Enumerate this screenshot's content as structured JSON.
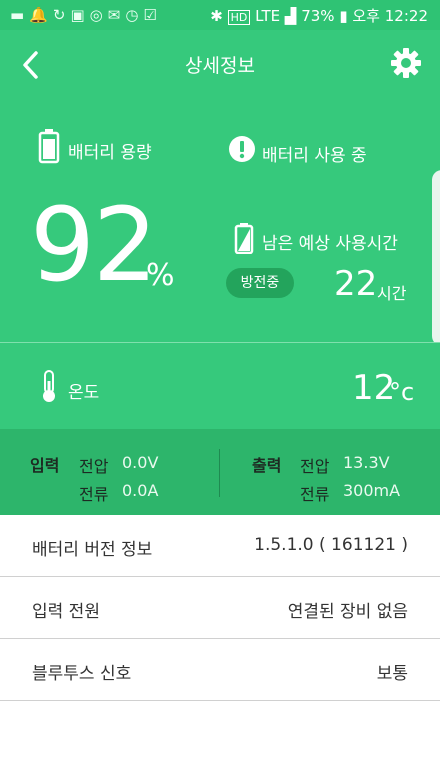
{
  "status_bar": {
    "notification_icons": [
      "message-icon",
      "bell-icon",
      "sync-icon",
      "image-icon",
      "refresh-icon",
      "mail-icon",
      "alarm-icon",
      "checkmark-icon"
    ],
    "battery_percent": "73%",
    "ampm": "오후",
    "time": "12:22",
    "network": "LTE"
  },
  "header": {
    "title": "상세정보"
  },
  "battery": {
    "capacity_label": "배터리 용량",
    "percent_value": "92",
    "percent_unit": "%",
    "in_use_label": "배터리 사용 중",
    "remaining_label": "남은 예상 사용시간",
    "discharge_badge": "방전중",
    "remaining_hours": "22",
    "hours_unit": "시간"
  },
  "temperature": {
    "label": "온도",
    "value": "12",
    "unit": "°c"
  },
  "io": {
    "input_title": "입력",
    "input_voltage_label": "전압",
    "input_voltage": "0.0V",
    "input_current_label": "전류",
    "input_current": "0.0A",
    "output_title": "출력",
    "output_voltage_label": "전압",
    "output_voltage": "13.3V",
    "output_current_label": "전류",
    "output_current": "300mA"
  },
  "info_rows": [
    {
      "label": "배터리 버전 정보",
      "value": "1.5.1.0 ( 161121 )"
    },
    {
      "label": "입력 전원",
      "value": "연결된 장비 없음"
    },
    {
      "label": "블루투스 신호",
      "value": "보통"
    }
  ],
  "colors": {
    "primary_green": "#36c97c",
    "dark_green": "#2db56b",
    "badge_green": "#23a45c"
  }
}
